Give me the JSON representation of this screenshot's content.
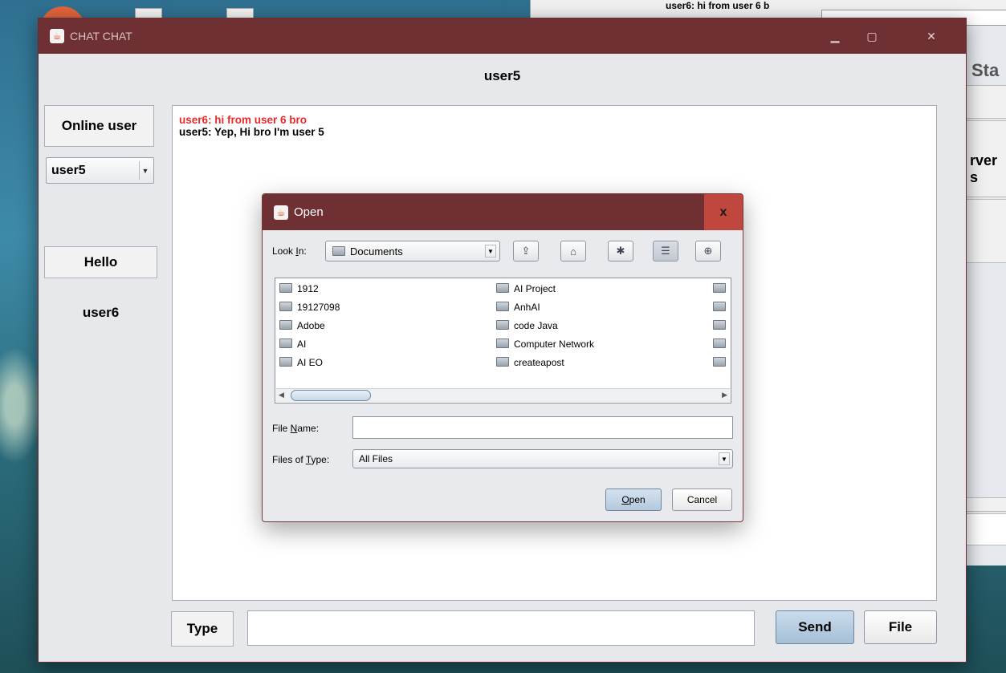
{
  "background": {
    "other_window_snippet": "user6: hi from user 6 b",
    "other_window_label": "Sta",
    "other_window_side_label": "rver s"
  },
  "chat_window": {
    "title": "CHAT CHAT",
    "heading": "user5",
    "online_user_label": "Online user",
    "user_select_value": "user5",
    "hello_label": "Hello",
    "peer_label": "user6",
    "messages": [
      {
        "text": "user6: hi from user 6 bro",
        "color": "#e82a2a"
      },
      {
        "text": "user5: Yep, Hi bro I'm user 5",
        "color": "#000000"
      }
    ],
    "type_label": "Type",
    "type_value": "",
    "send_label": "Send",
    "file_label": "File"
  },
  "open_dialog": {
    "title": "Open",
    "close_glyph": "x",
    "look_in_label_pre": "Look ",
    "look_in_label_key": "I",
    "look_in_label_post": "n:",
    "look_in_value": "Documents",
    "toolbar_icons": [
      "up-one-level-icon",
      "home-icon",
      "new-folder-icon",
      "list-view-icon",
      "details-view-icon"
    ],
    "files_col1": [
      "1912",
      "19127098",
      "Adobe",
      "AI",
      "AI EO"
    ],
    "files_col2": [
      "AI Project",
      "AnhAI",
      "code Java",
      "Computer Network",
      "createapost"
    ],
    "file_name_label_pre": "File ",
    "file_name_label_key": "N",
    "file_name_label_post": "ame:",
    "file_name_value": "",
    "files_of_type_label_pre": "Files of ",
    "files_of_type_label_key": "T",
    "files_of_type_label_post": "ype:",
    "files_of_type_value": "All Files",
    "open_button_key": "O",
    "open_button_rest": "pen",
    "cancel_button": "Cancel"
  }
}
